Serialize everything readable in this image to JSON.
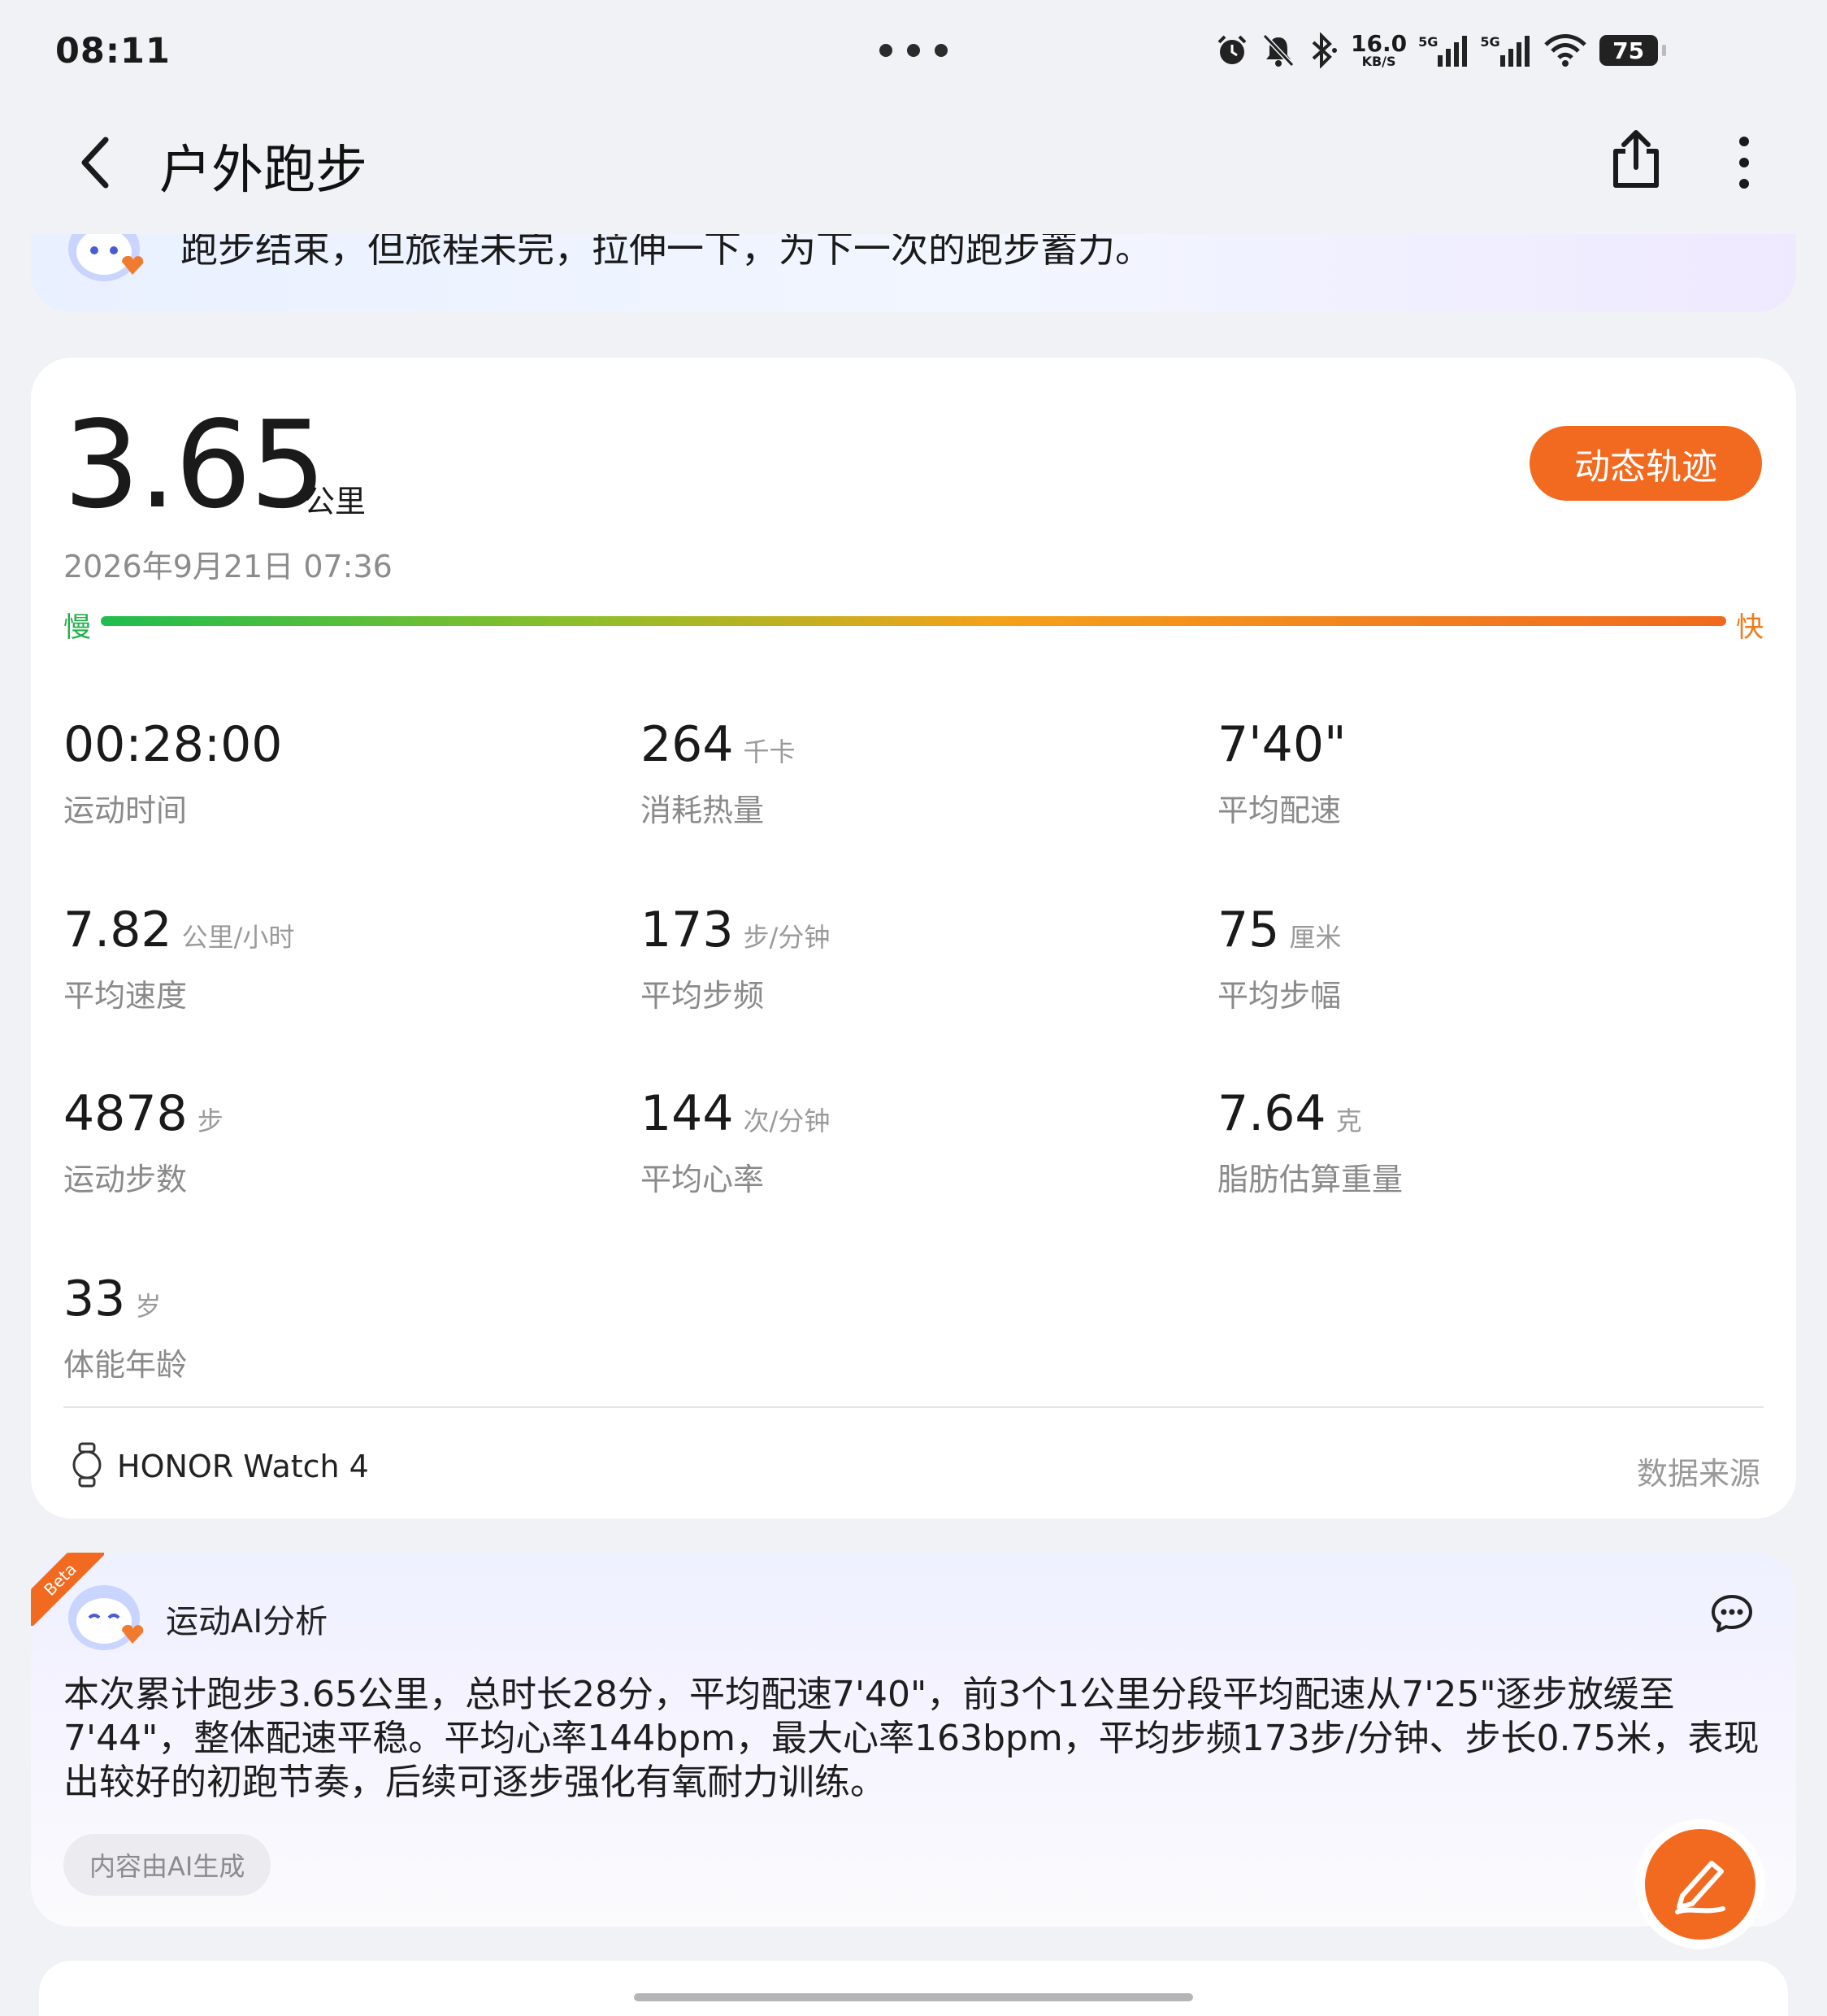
{
  "status_bar": {
    "time": "08:11",
    "net_speed_value": "16.0",
    "net_speed_unit": "KB/S",
    "sim1": "5G",
    "sim2": "5G",
    "battery": "75"
  },
  "header": {
    "title": "户外跑步"
  },
  "banner": {
    "text": "跑步结束，但旅程未完，拉伸一下，为下一次的跑步蓄力。"
  },
  "summary": {
    "distance": "3.65",
    "distance_unit": "公里",
    "datetime": "2026年9月21日 07:36",
    "track_button": "动态轨迹",
    "pace_slow": "慢",
    "pace_fast": "快"
  },
  "metrics": [
    {
      "value": "00:28:00",
      "unit": "",
      "label": "运动时间"
    },
    {
      "value": "264",
      "unit": "千卡",
      "label": "消耗热量"
    },
    {
      "value": "7'40\"",
      "unit": "",
      "label": "平均配速"
    },
    {
      "value": "7.82",
      "unit": "公里/小时",
      "label": "平均速度"
    },
    {
      "value": "173",
      "unit": "步/分钟",
      "label": "平均步频"
    },
    {
      "value": "75",
      "unit": "厘米",
      "label": "平均步幅"
    },
    {
      "value": "4878",
      "unit": "步",
      "label": "运动步数"
    },
    {
      "value": "144",
      "unit": "次/分钟",
      "label": "平均心率"
    },
    {
      "value": "7.64",
      "unit": "克",
      "label": "脂肪估算重量"
    },
    {
      "value": "33",
      "unit": "岁",
      "label": "体能年龄"
    }
  ],
  "device": {
    "name": "HONOR Watch 4",
    "source_link": "数据来源"
  },
  "ai_analysis": {
    "badge": "Beta",
    "title": "运动AI分析",
    "text": "本次累计跑步3.65公里，总时长28分，平均配速7'40\"，前3个1公里分段平均配速从7'25\"逐步放缓至7'44\"，整体配速平稳。平均心率144bpm，最大心率163bpm，平均步频173步/分钟、步长0.75米，表现出较好的初跑节奏，后续可逐步强化有氧耐力训练。",
    "tag": "内容由AI生成"
  },
  "colors": {
    "accent": "#f26a1f",
    "pace_slow": "#22b04a",
    "pace_fast": "#f07b1e"
  },
  "icons": [
    "alarm-icon",
    "mute-icon",
    "bluetooth-icon",
    "signal-icon",
    "wifi-icon",
    "battery-icon",
    "back-icon",
    "share-icon",
    "more-icon",
    "watch-icon",
    "chat-icon",
    "edit-icon"
  ]
}
